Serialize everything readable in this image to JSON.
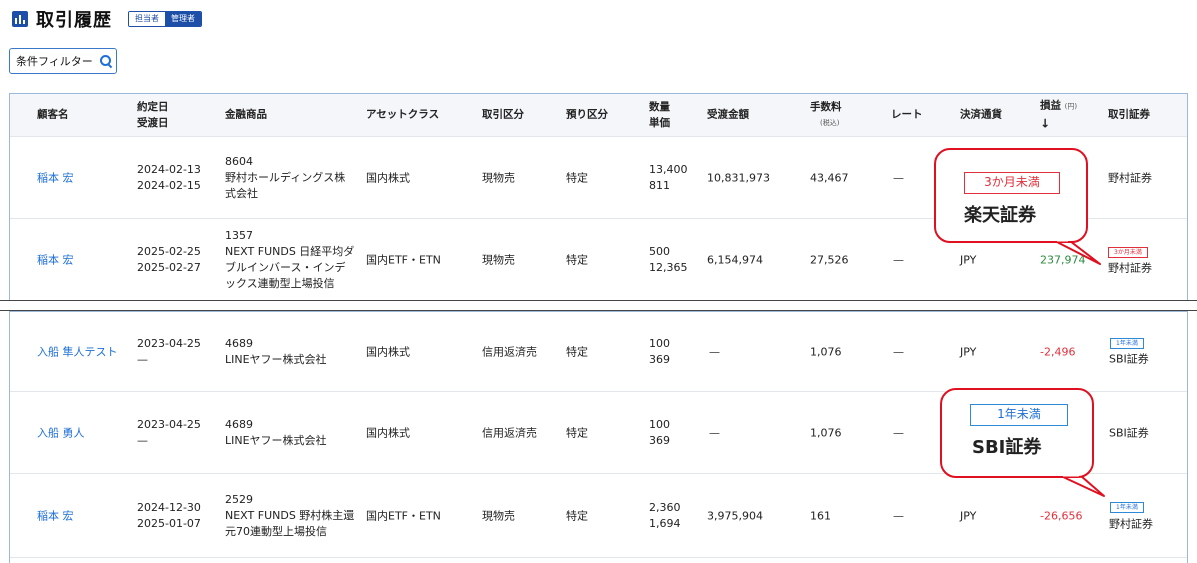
{
  "header": {
    "title": "取引履歴",
    "roles": [
      "担当者",
      "管理者"
    ],
    "active_role": "管理者"
  },
  "filter": {
    "label": "条件フィルター"
  },
  "columns": {
    "customer": "顧客名",
    "date1": "約定日",
    "date2": "受渡日",
    "product": "金融商品",
    "asset": "アセットクラス",
    "trade_type": "取引区分",
    "custody": "預り区分",
    "qty": "数量",
    "price": "単価",
    "amount": "受渡金額",
    "fee": "手数料",
    "fee_note": "(税込)",
    "rate": "レート",
    "currency": "決済通貨",
    "pnl": "損益",
    "pnl_unit": "(円)",
    "pnl_sort": "↓",
    "broker": "取引証券"
  },
  "rows_top": [
    {
      "customer": "稲本 宏",
      "trade_date": "2024-02-13",
      "settle_date": "2024-02-15",
      "code": "8604",
      "name1": "野村ホールディングス株",
      "name2": "式会社",
      "name3": "",
      "asset": "国内株式",
      "trade_type": "現物売",
      "custody": "特定",
      "qty": "13,400",
      "price": "811",
      "amount": "10,831,973",
      "fee": "43,467",
      "rate": "—",
      "currency": "",
      "pnl": "",
      "badge": "",
      "broker": "野村証券"
    },
    {
      "customer": "稲本 宏",
      "trade_date": "2025-02-25",
      "settle_date": "2025-02-27",
      "code": "1357",
      "name1": "NEXT FUNDS 日経平均ダ",
      "name2": "ブルインバース・インデ",
      "name3": "ックス連動型上場投信",
      "asset": "国内ETF・ETN",
      "trade_type": "現物売",
      "custody": "特定",
      "qty": "500",
      "price": "12,365",
      "amount": "6,154,974",
      "fee": "27,526",
      "rate": "—",
      "currency": "JPY",
      "pnl": "237,974",
      "badge": "3か月未満",
      "broker": "野村証券"
    }
  ],
  "rows_bottom": [
    {
      "customer": "入船 隼人テスト",
      "trade_date": "2023-04-25",
      "settle_date": "—",
      "code": "4689",
      "name1": "LINEヤフー株式会社",
      "name2": "",
      "asset": "国内株式",
      "trade_type": "信用返済売",
      "custody": "特定",
      "qty": "100",
      "price": "369",
      "amount": "—",
      "fee": "1,076",
      "rate": "—",
      "currency": "JPY",
      "pnl": "-2,496",
      "badge": "1年未満",
      "broker": "SBI証券"
    },
    {
      "customer": "入船 勇人",
      "trade_date": "2023-04-25",
      "settle_date": "—",
      "code": "4689",
      "name1": "LINEヤフー株式会社",
      "name2": "",
      "asset": "国内株式",
      "trade_type": "信用返済売",
      "custody": "特定",
      "qty": "100",
      "price": "369",
      "amount": "—",
      "fee": "1,076",
      "rate": "—",
      "currency": "",
      "pnl": "",
      "badge": "",
      "broker": "SBI証券"
    },
    {
      "customer": "稲本 宏",
      "trade_date": "2024-12-30",
      "settle_date": "2025-01-07",
      "code": "2529",
      "name1": "NEXT FUNDS 野村株主還",
      "name2": "元70連動型上場投信",
      "asset": "国内ETF・ETN",
      "trade_type": "現物売",
      "custody": "特定",
      "qty": "2,360",
      "price": "1,694",
      "amount": "3,975,904",
      "fee": "161",
      "rate": "—",
      "currency": "JPY",
      "pnl": "-26,656",
      "badge": "1年未満",
      "broker": "野村証券"
    }
  ],
  "callouts": {
    "top": {
      "tag": "3か月未満",
      "text": "楽天証券"
    },
    "bottom": {
      "tag": "1年未満",
      "text": "SBI証券"
    }
  },
  "colors": {
    "link": "#1d6fd6",
    "positive": "#2e8b3e",
    "negative": "#e0303b",
    "callout_border": "#e01020"
  }
}
